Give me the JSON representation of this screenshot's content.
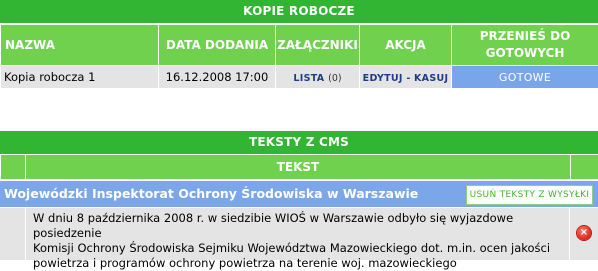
{
  "kopie_robocze": {
    "title": "KOPIE ROBOCZE",
    "headers": {
      "nazwa": "NAZWA",
      "data_dodania": "DATA DODANIA",
      "zalaczniki": "ZAŁĄCZNIKI",
      "akcja": "AKCJA",
      "przenies_line1": "PRZENIEŚ DO",
      "przenies_line2": "GOTOWYCH"
    },
    "rows": [
      {
        "name": "Kopia robocza 1",
        "date": "16.12.2008 17:00",
        "attachments_link": "LISTA",
        "attachments_count": "(0)",
        "edit": "EDYTUJ",
        "separator": "-",
        "delete": "KASUJ",
        "ready": "GOTOWE"
      }
    ]
  },
  "teksty_cms": {
    "title": "TEKSTY Z CMS",
    "header_tekst": "TEKST",
    "group": {
      "title": "Wojewódzki Inspektorat Ochrony Środowiska w Warszawie",
      "remove_button": "USUŃ TEKSTY Z WYSYŁKI"
    },
    "items": [
      {
        "line1": "W dniu 8 października 2008 r. w siedzibie WIOŚ w Warszawie odbyło się wyjazdowe posiedzenie",
        "line2": "Komisji Ochrony Środowiska Sejmiku Województwa Mazowieckiego dot. m.in. ocen jakości",
        "line3": "powietrza i programów ochrony powietrza na terenie woj. mazowieckiego",
        "delete_icon": "delete-circle-icon"
      }
    ]
  },
  "colors": {
    "green_dark": "#32b533",
    "green_light": "#70d14f",
    "blue": "#7ba7ea",
    "row_gray": "#e4e4e4",
    "link_blue": "#1e3c8c"
  }
}
